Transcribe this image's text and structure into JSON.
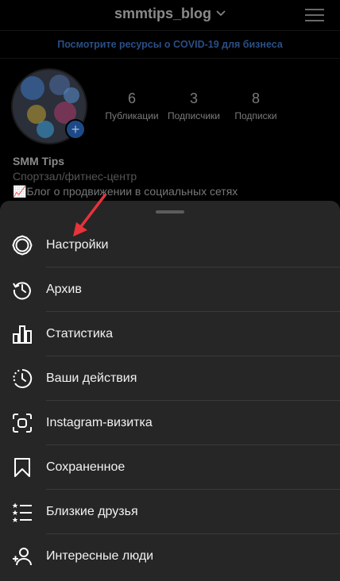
{
  "header": {
    "username": "smmtips_blog"
  },
  "banner": {
    "text": "Посмотрите ресурсы о COVID-19 для бизнеса"
  },
  "profile": {
    "stats": [
      {
        "num": "6",
        "label": "Публикации"
      },
      {
        "num": "3",
        "label": "Подписчики"
      },
      {
        "num": "8",
        "label": "Подписки"
      }
    ],
    "name": "SMM Tips",
    "category": "Спортзал/фитнес-центр",
    "desc": "📈Блог о продвижении в социальных сетях"
  },
  "menu": {
    "items": [
      {
        "label": "Настройки",
        "icon": "gear-icon"
      },
      {
        "label": "Архив",
        "icon": "archive-history-icon"
      },
      {
        "label": "Статистика",
        "icon": "bar-chart-icon"
      },
      {
        "label": "Ваши действия",
        "icon": "activity-clock-icon"
      },
      {
        "label": "Instagram-визитка",
        "icon": "qr-scan-icon"
      },
      {
        "label": "Сохраненное",
        "icon": "bookmark-icon"
      },
      {
        "label": "Близкие друзья",
        "icon": "close-friends-list-icon"
      },
      {
        "label": "Интересные люди",
        "icon": "add-person-icon"
      }
    ]
  },
  "colors": {
    "sheet_bg": "#262626",
    "annotation_arrow": "#e8333a",
    "banner_text": "#2a4f86"
  }
}
